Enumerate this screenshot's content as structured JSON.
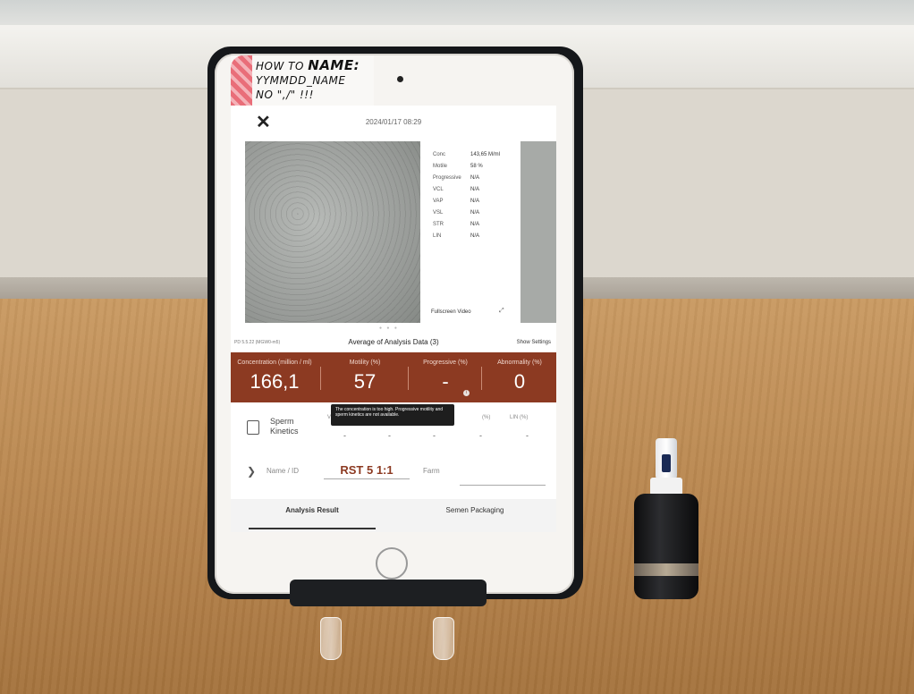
{
  "handwriting": {
    "line1": "HOW TO",
    "line1_bold": "NAME:",
    "line2": "YYMMDD_NAME",
    "line3": "NO \",/\" !!!"
  },
  "app": {
    "datetime": "2024/01/17 08:29",
    "close_icon": "close-icon"
  },
  "video_stats": [
    {
      "key": "Conc",
      "value": "143,65 M/ml"
    },
    {
      "key": "Motile",
      "value": "58 %"
    },
    {
      "key": "Progressive",
      "value": "N/A"
    },
    {
      "key": "VCL",
      "value": "N/A"
    },
    {
      "key": "VAP",
      "value": "N/A"
    },
    {
      "key": "VSL",
      "value": "N/A"
    },
    {
      "key": "STR",
      "value": "N/A"
    },
    {
      "key": "LIN",
      "value": "N/A"
    }
  ],
  "fullscreen_label": "Fullscreen Video",
  "version": "PD 5.5.22 (MGW0-m5)",
  "average_title": "Average of Analysis Data (3)",
  "show_settings": "Show Settings",
  "metrics": [
    {
      "label": "Concentration (million / ml)",
      "value": "166,1"
    },
    {
      "label": "Motility (%)",
      "value": "57"
    },
    {
      "label": "Progressive (%)",
      "value": "-"
    },
    {
      "label": "Abnormality (%)",
      "value": "0"
    }
  ],
  "tooltip": "The concentration is too high. Progressive motility and sperm kinetics are not available.",
  "kinetics": {
    "label_line1": "Sperm",
    "label_line2": "Kinetics",
    "head_visible_1": "V",
    "head_visible_2": "(%)",
    "head_visible_3": "LIN (%)",
    "values": [
      "-",
      "-",
      "-",
      "-",
      "-"
    ]
  },
  "name_field": {
    "label": "Name / ID",
    "value": "RST 5 1:1"
  },
  "farm_field": {
    "label": "Farm",
    "value": ""
  },
  "tabs": [
    {
      "label": "Analysis Result",
      "active": true
    },
    {
      "label": "Semen Packaging",
      "active": false
    }
  ],
  "colors": {
    "accent": "#8c3a22"
  }
}
